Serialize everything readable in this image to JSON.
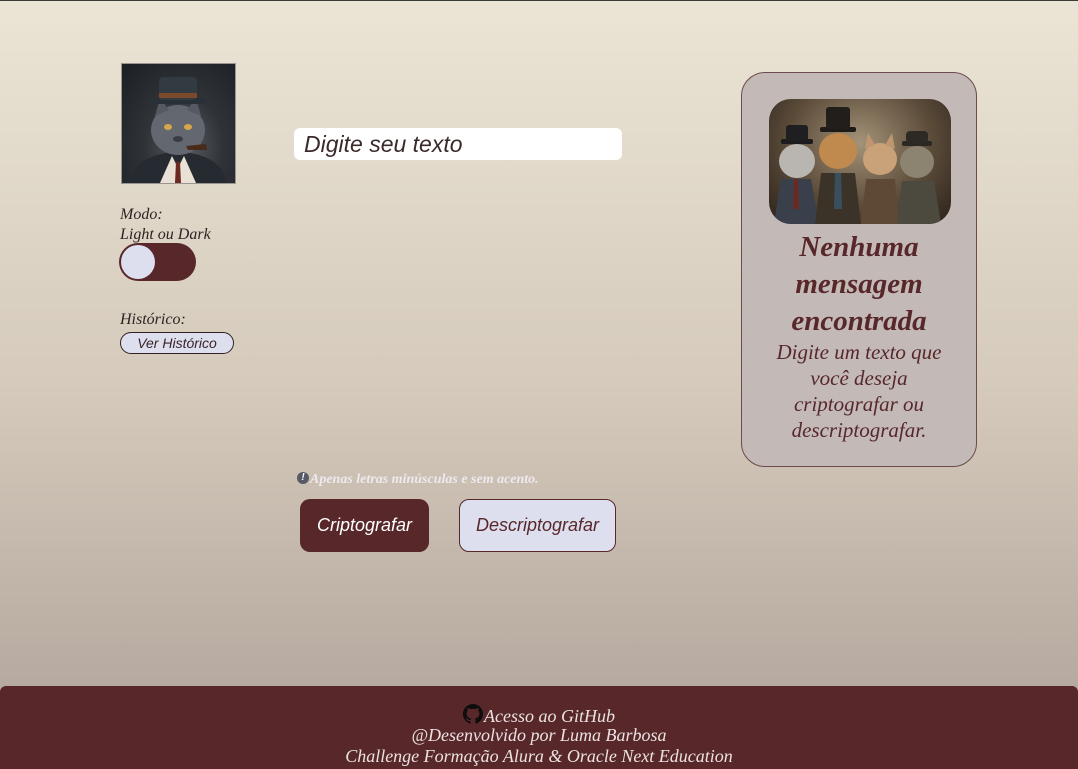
{
  "sidebar": {
    "mode_label": "Modo:",
    "mode_sublabel": "Light ou Dark",
    "theme_toggle_state": "light",
    "history_label": "Histórico:",
    "history_button": "Ver Histórico"
  },
  "main": {
    "input_placeholder": "Digite seu texto",
    "input_value": "",
    "warning_icon": "exclamation-circle-icon",
    "warning_text": "Apenas letras minúsculas e sem acento.",
    "encrypt_button": "Criptografar",
    "decrypt_button": "Descriptografar"
  },
  "result_panel": {
    "title": "Nenhuma mensagem encontrada",
    "description": "Digite um texto que você deseja criptografar ou descriptografar."
  },
  "footer": {
    "github_icon": "github-icon",
    "github_link": "Acesso ao GitHub",
    "credit": "@Desenvolvido por Luma Barbosa",
    "challenge": "Challenge Formação Alura & Oracle Next Education"
  },
  "colors": {
    "primary": "#57272a",
    "secondary": "#dedfee",
    "panel_bg": "#c3bab8",
    "input_bg": "#ffffff"
  }
}
